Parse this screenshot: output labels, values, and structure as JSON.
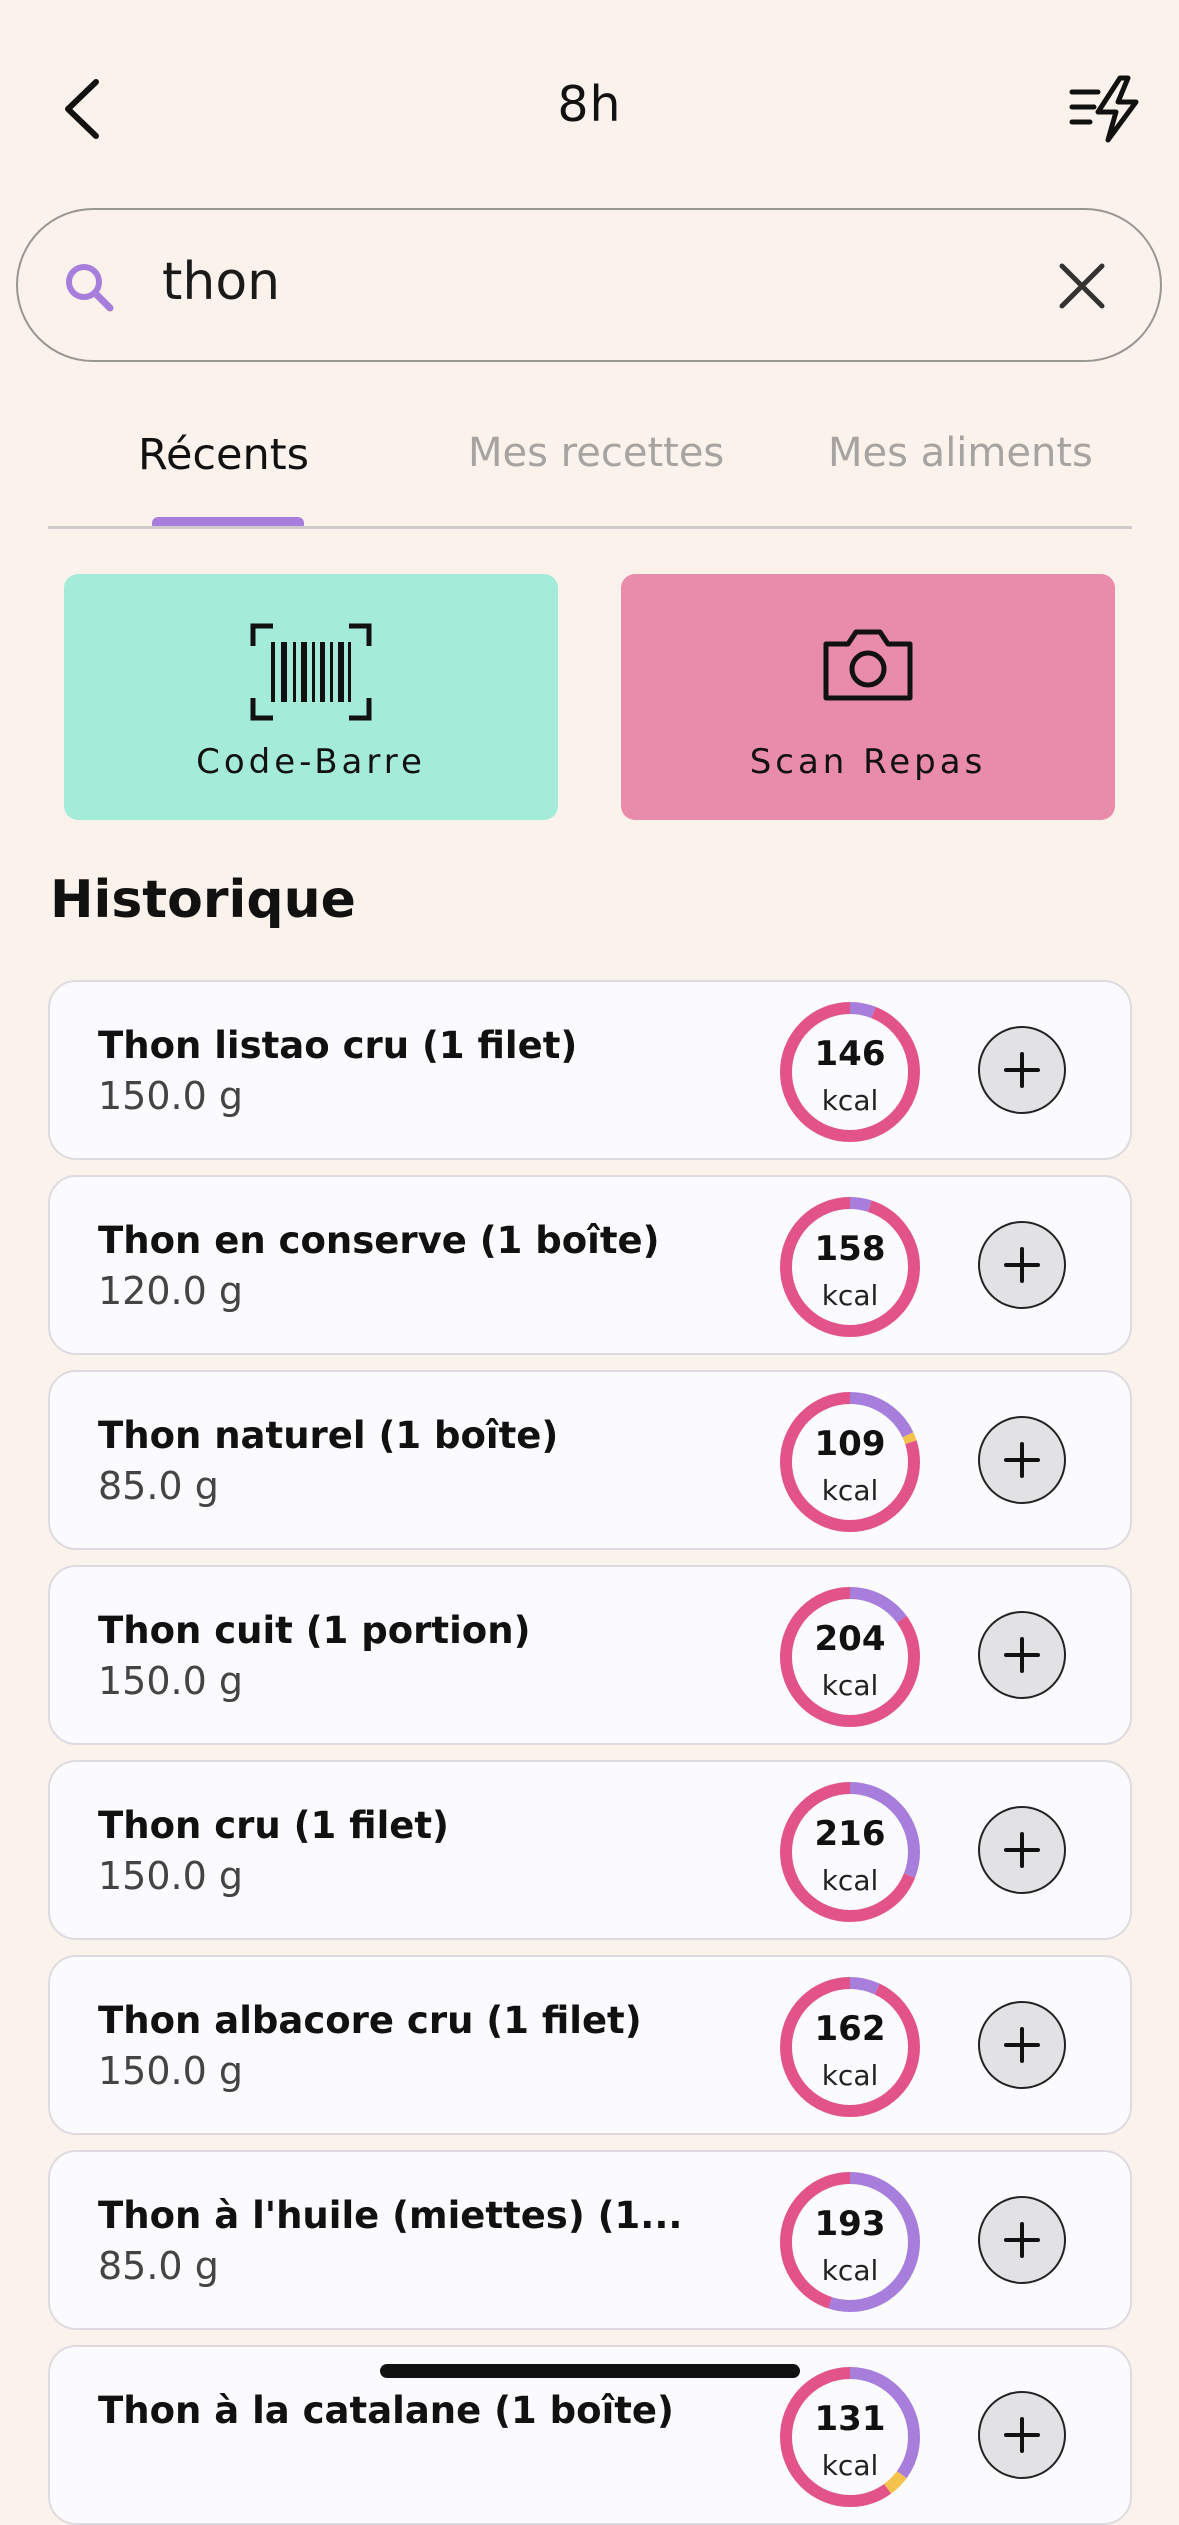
{
  "header": {
    "title": "8h",
    "back_icon": "chevron-left-icon",
    "quick_icon": "quick-add-lightning-icon"
  },
  "search": {
    "value": "thon",
    "icon": "search-icon",
    "clear_icon": "close-icon",
    "accent": "#A77EDB"
  },
  "tabs": [
    {
      "label": "Récents",
      "active": true
    },
    {
      "label": "Mes recettes",
      "active": false
    },
    {
      "label": "Mes aliments",
      "active": false
    }
  ],
  "actions": {
    "barcode": {
      "label": "Code-Barre",
      "icon": "barcode-icon",
      "color": "#A4EBD9"
    },
    "scan": {
      "label": "Scan Repas",
      "icon": "camera-icon",
      "color": "#E98BAA"
    }
  },
  "history": {
    "title": "Historique",
    "items": [
      {
        "name": "Thon listao cru (1 filet)",
        "qty": "150.0 g",
        "kcal": "146",
        "unit": "kcal",
        "macros": {
          "protein": 0.94,
          "carbs": 0.0,
          "fat": 0.06
        }
      },
      {
        "name": "Thon en conserve (1 boîte)",
        "qty": "120.0 g",
        "kcal": "158",
        "unit": "kcal",
        "macros": {
          "protein": 0.95,
          "carbs": 0.0,
          "fat": 0.05
        }
      },
      {
        "name": "Thon naturel (1 boîte)",
        "qty": "85.0 g",
        "kcal": "109",
        "unit": "kcal",
        "macros": {
          "protein": 0.8,
          "carbs": 0.02,
          "fat": 0.18
        }
      },
      {
        "name": "Thon cuit (1 portion)",
        "qty": "150.0 g",
        "kcal": "204",
        "unit": "kcal",
        "macros": {
          "protein": 0.85,
          "carbs": 0.0,
          "fat": 0.15
        }
      },
      {
        "name": "Thon cru (1 filet)",
        "qty": "150.0 g",
        "kcal": "216",
        "unit": "kcal",
        "macros": {
          "protein": 0.69,
          "carbs": 0.0,
          "fat": 0.31
        }
      },
      {
        "name": "Thon albacore cru (1 filet)",
        "qty": "150.0 g",
        "kcal": "162",
        "unit": "kcal",
        "macros": {
          "protein": 0.93,
          "carbs": 0.0,
          "fat": 0.07
        }
      },
      {
        "name": "Thon à l'huile (miettes) (1...",
        "qty": "85.0 g",
        "kcal": "193",
        "unit": "kcal",
        "macros": {
          "protein": 0.45,
          "carbs": 0.0,
          "fat": 0.55
        }
      },
      {
        "name": "Thon à la catalane (1 boîte)",
        "qty": "",
        "kcal": "131",
        "unit": "kcal",
        "macros": {
          "protein": 0.6,
          "carbs": 0.05,
          "fat": 0.35
        }
      }
    ]
  },
  "colors": {
    "protein": "#E25489",
    "carbs": "#F2C24A",
    "fat": "#A77EDB",
    "background": "#FAF2EB"
  }
}
